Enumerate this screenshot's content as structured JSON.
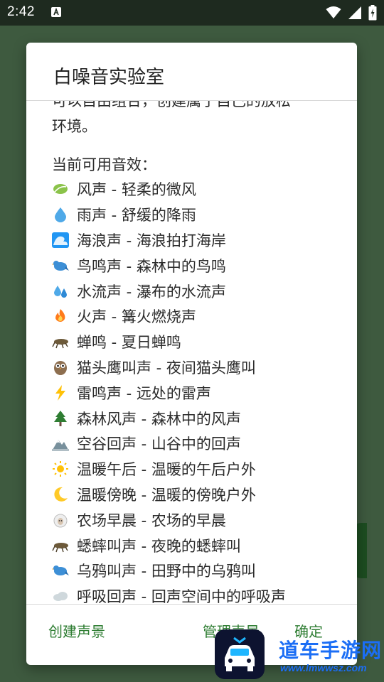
{
  "status_bar": {
    "time": "2:42"
  },
  "dialog": {
    "title": "白噪音实验室",
    "intro_partial": "可以自由组合，创建属于自己的放松",
    "intro_tail": "环境。",
    "section_heading": "当前可用音效：",
    "sounds": [
      {
        "icon": "leaf-icon",
        "text": "风声 - 轻柔的微风"
      },
      {
        "icon": "droplet-icon",
        "text": "雨声 - 舒缓的降雨"
      },
      {
        "icon": "wave-icon",
        "text": "海浪声 - 海浪拍打海岸"
      },
      {
        "icon": "bird-icon",
        "text": "鸟鸣声 - 森林中的鸟鸣"
      },
      {
        "icon": "sweat-droplets-icon",
        "text": "水流声 - 瀑布的水流声"
      },
      {
        "icon": "fire-icon",
        "text": "火声 - 篝火燃烧声"
      },
      {
        "icon": "cricket-icon",
        "text": "蝉鸣 - 夏日蝉鸣"
      },
      {
        "icon": "owl-icon",
        "text": "猫头鹰叫声 - 夜间猫头鹰叫"
      },
      {
        "icon": "lightning-icon",
        "text": "雷鸣声 - 远处的雷声"
      },
      {
        "icon": "evergreen-tree-icon",
        "text": "森林风声 - 森林中的风声"
      },
      {
        "icon": "snow-mountain-icon",
        "text": "空谷回声 - 山谷中的回声"
      },
      {
        "icon": "sun-icon",
        "text": "温暖午后 - 温暖的午后户外"
      },
      {
        "icon": "crescent-moon-icon",
        "text": "温暖傍晚 - 温暖的傍晚户外"
      },
      {
        "icon": "sheep-icon",
        "text": "农场早晨 - 农场的早晨"
      },
      {
        "icon": "cricket-icon",
        "text": "蟋蟀叫声 - 夜晚的蟋蟀叫"
      },
      {
        "icon": "bird-icon",
        "text": "乌鸦叫声 - 田野中的乌鸦叫"
      },
      {
        "icon": "cloud-icon",
        "text": "呼吸回声 - 回声空间中的呼吸声"
      }
    ],
    "buttons": {
      "create": "创建声景",
      "manage": "管理声景",
      "ok": "确定"
    }
  },
  "watermark": {
    "name": "道车手游网",
    "url": "www.lmwwsz.com"
  },
  "colors": {
    "accent": "#2e7d32",
    "status_bar": "#1e2a1f",
    "scrim": "#3e5a3f",
    "watermark_blue": "#1b6ef5"
  }
}
